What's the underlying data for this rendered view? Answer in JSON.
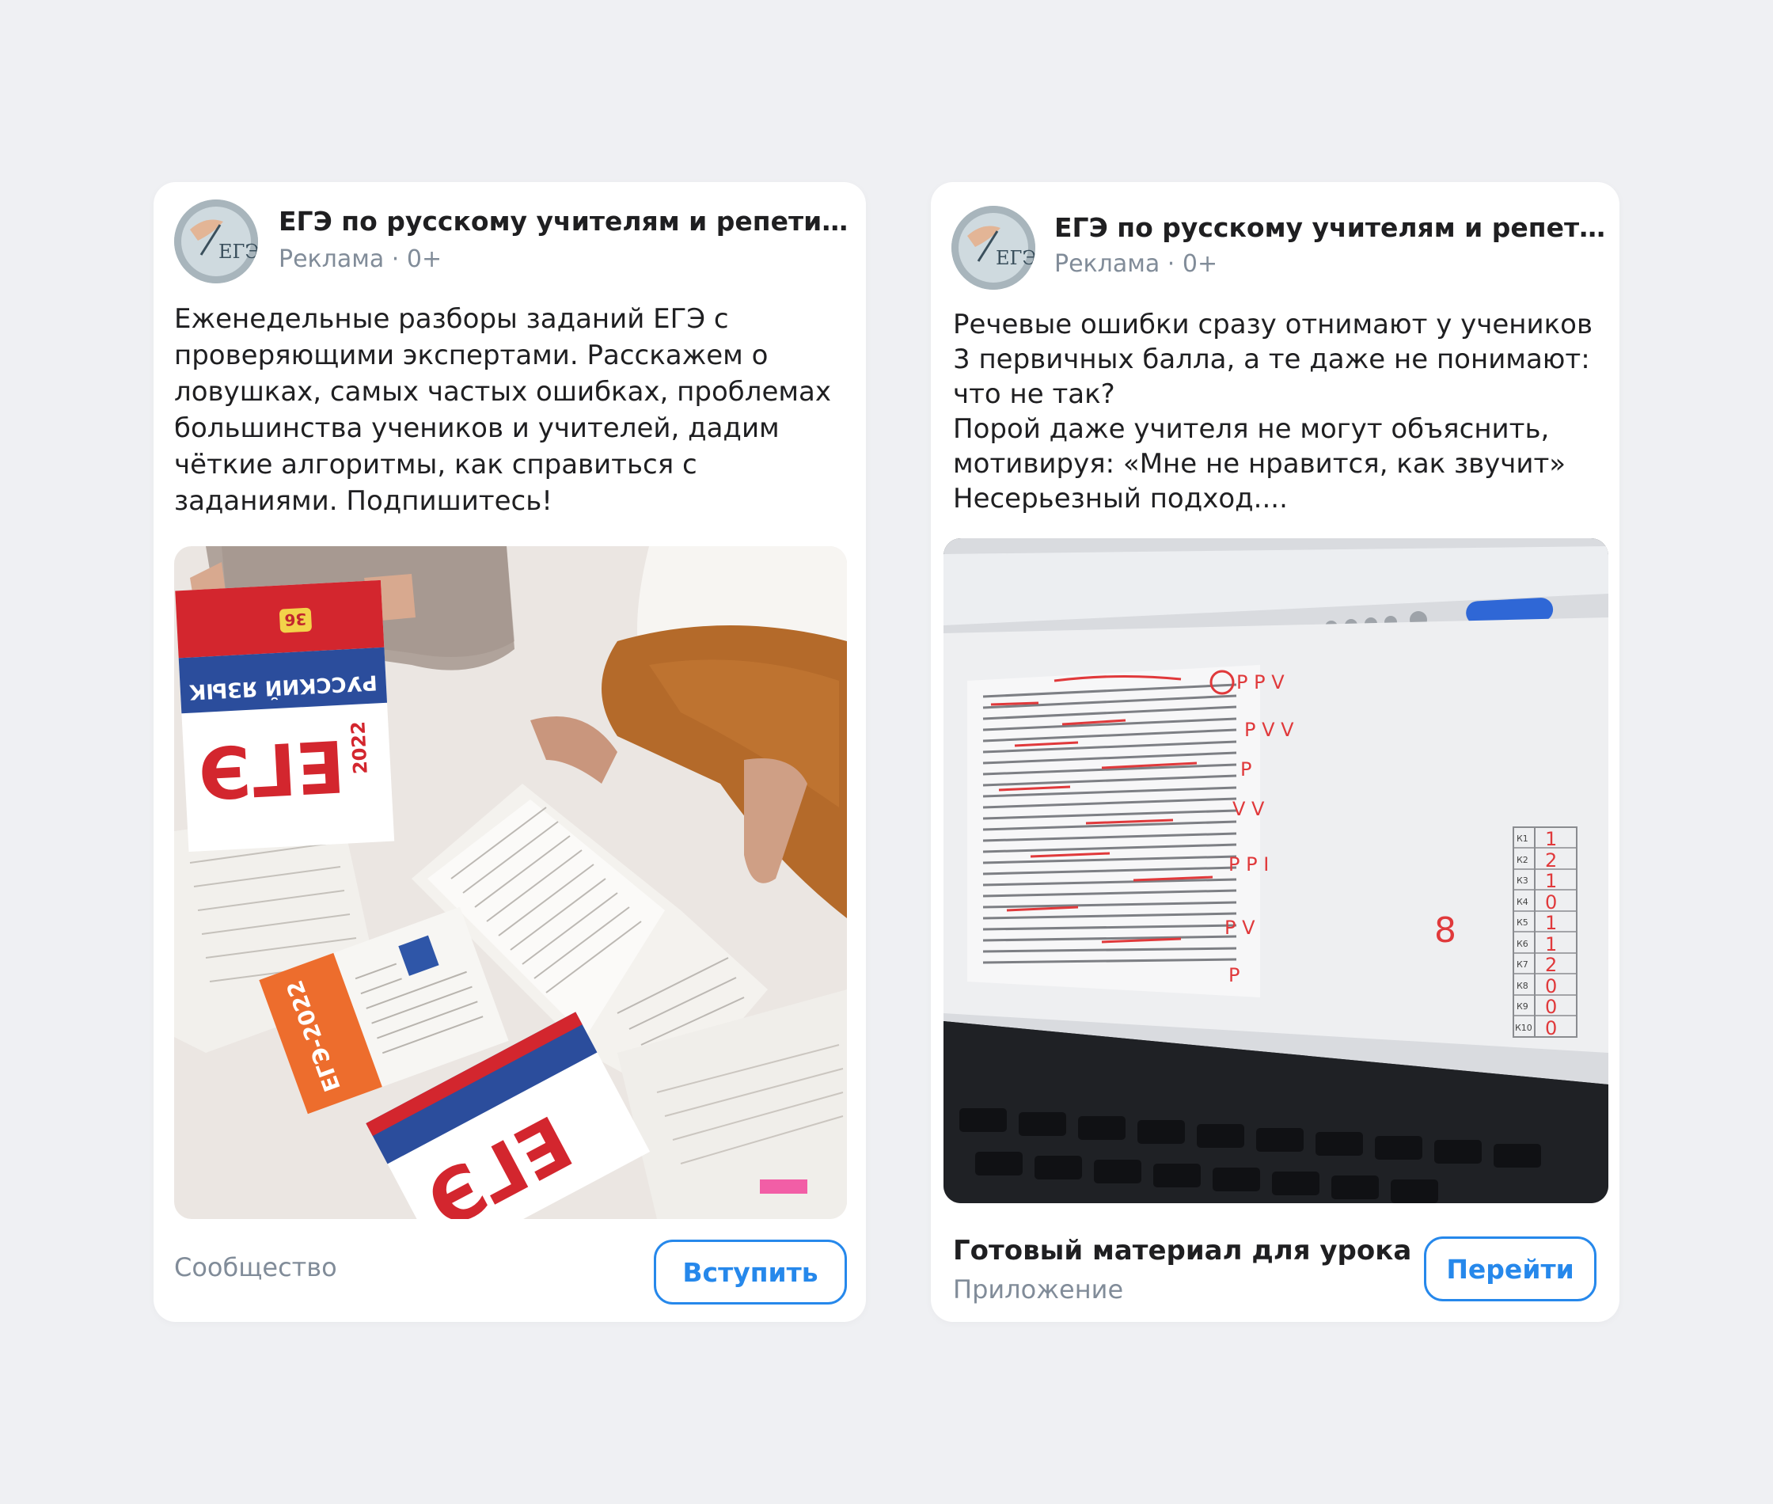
{
  "cards": [
    {
      "title": "ЕГЭ по русскому учителям и репети…",
      "meta": "Реклама · 0+",
      "avatar_text": "ЕГЭ",
      "text": "Еженедельные разборы заданий ЕГЭ с\nпроверяющими экспертами. Расскажем о\nловушках, самых частых ошибках, проблемах\nбольшинства учеников и учителей, дадим\nчёткие алгоритмы, как справиться с\nзаданиями. Подпишитесь!",
      "photo_labels": {
        "book_brand": "ЕГЭ",
        "book_subject": "РУССКИЙ ЯЗЫК",
        "book_year": "2022",
        "orange_book": "ЕГЭ-2022",
        "badge_number": "36"
      },
      "footer_label": "Сообщество",
      "cta_label": "Вступить"
    },
    {
      "title": "ЕГЭ по русскому учителям и репети…",
      "meta": "Реклама · 0+",
      "avatar_text": "ЕГЭ",
      "text": "Речевые ошибки сразу отнимают у учеников\n3 первичных балла, а те даже не понимают:\nчто не так?\nПорой даже учителя не могут объяснить,\nмотивируя: «Мне не нравится, как звучит»\nНесерьезный подход....",
      "screen": {
        "total_score": "8",
        "criteria": [
          "К1",
          "К2",
          "К3",
          "К4",
          "К5",
          "К6",
          "К7",
          "К8",
          "К9",
          "К10"
        ],
        "scores": [
          "1",
          "2",
          "1",
          "0",
          "1",
          "1",
          "2",
          "0",
          "0",
          "0"
        ]
      },
      "footer_title": "Готовый материал для урока",
      "footer_label": "Приложение",
      "cta_label": "Перейти"
    }
  ]
}
